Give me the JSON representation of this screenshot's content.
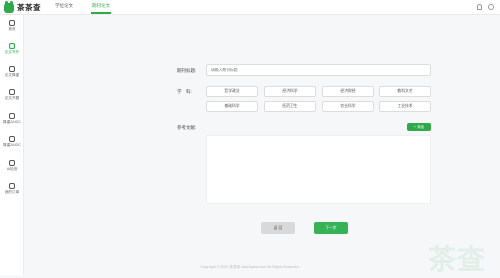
{
  "app": {
    "name": "茶茶查"
  },
  "tabs": [
    {
      "label": "学位论文"
    },
    {
      "label": "期刊论文"
    }
  ],
  "sidebar": {
    "items": [
      {
        "label": "首页",
        "icon": "home-icon"
      },
      {
        "label": "论文写作",
        "icon": "edit-icon",
        "active": true
      },
      {
        "label": "论文降重",
        "icon": "rewrite-icon"
      },
      {
        "label": "论文开题",
        "icon": "open-topic-icon"
      },
      {
        "label": "降重2AIGC",
        "icon": "aigc-reduce-icon"
      },
      {
        "label": "降重2AIGC",
        "icon": "aigc-reduce-icon-2"
      },
      {
        "label": "AI检测",
        "icon": "ai-detect-icon"
      },
      {
        "label": "我的订单",
        "icon": "order-icon"
      }
    ]
  },
  "form": {
    "title_label": "期刊标题:",
    "title_placeholder": "请输入期刊标题",
    "subject_label": "学　科:",
    "subjects": [
      "哲学政法",
      "经济科学",
      "经济财经",
      "教科文艺",
      "基础科学",
      "医药卫生",
      "农业科学",
      "工业技术"
    ],
    "ref_label": "参考文献:",
    "add_label": "添加"
  },
  "buttons": {
    "back": "返 回",
    "next": "下一步"
  },
  "footer": "Copyright © 2023 茶茶查 chachacha.com All Rights Reserved.",
  "watermark": "茶查",
  "colors": {
    "accent": "#2faa4a"
  }
}
